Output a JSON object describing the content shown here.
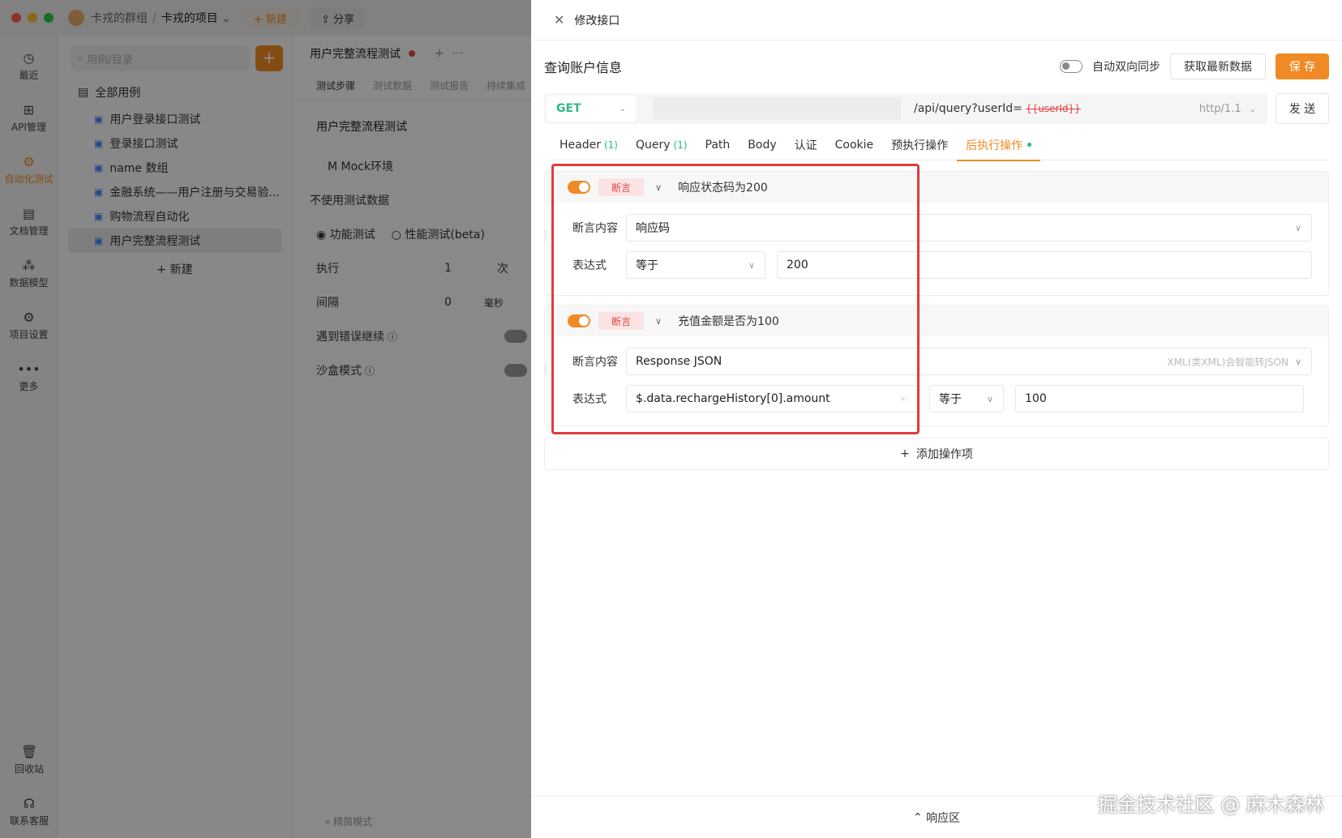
{
  "app": {
    "team": "卡戎的群组",
    "project": "卡戎的项目",
    "new_btn": "+ 新建",
    "share_btn": "分享"
  },
  "nav": {
    "items": [
      {
        "label": "最近",
        "icon": "clock-icon",
        "glyph": "◷"
      },
      {
        "label": "API管理",
        "icon": "api-icon",
        "glyph": "⊞"
      },
      {
        "label": "自动化测试",
        "icon": "automation-icon",
        "glyph": "⚙"
      },
      {
        "label": "文档管理",
        "icon": "document-icon",
        "glyph": "▤"
      },
      {
        "label": "数据模型",
        "icon": "model-icon",
        "glyph": "⁂"
      },
      {
        "label": "项目设置",
        "icon": "settings-icon",
        "glyph": "⚙"
      },
      {
        "label": "更多",
        "icon": "more-icon",
        "glyph": "•••"
      }
    ],
    "bottom": [
      {
        "label": "回收站",
        "icon": "trash-icon",
        "glyph": "🗑"
      },
      {
        "label": "联系客服",
        "icon": "headset-icon",
        "glyph": "☊"
      }
    ]
  },
  "tree": {
    "search_placeholder": "用例/目录",
    "add": "+",
    "root": "全部用例",
    "items": [
      "用户登录接口测试",
      "登录接口测试",
      "name 数组",
      "金融系统——用户注册与交易验...",
      "购物流程自动化",
      "用户完整流程测试"
    ],
    "new": "+ 新建"
  },
  "middle": {
    "tab_title": "用户完整流程测试",
    "tab_plus": "+",
    "tab_more": "···",
    "subtabs": [
      "测试步骤",
      "测试数据",
      "测试报告",
      "持续集成"
    ],
    "title": "用户完整流程测试",
    "env": "M  Mock环境",
    "test_data": "不使用测试数据",
    "mode_func": "功能测试",
    "mode_perf": "性能测试(beta)",
    "exec_label": "执行",
    "exec_value": "1",
    "exec_unit": "次",
    "interval_label": "间隔",
    "interval_value": "0",
    "interval_unit": "毫秒",
    "error_continue": "遇到错误继续",
    "sandbox": "沙盒模式",
    "compact": "精简模式"
  },
  "drawer": {
    "close": "✕",
    "title": "修改接口",
    "api_name": "查询账户信息",
    "sync_label": "自动双向同步",
    "fetch_btn": "获取最新数据",
    "save_btn": "保 存",
    "method": "GET",
    "path": "/api/query?userId=",
    "path_var": "{{userId}}",
    "protocol": "http/1.1",
    "send_btn": "发 送",
    "tabs": [
      {
        "label": "Header",
        "count": "(1)"
      },
      {
        "label": "Query",
        "count": "(1)"
      },
      {
        "label": "Path",
        "count": ""
      },
      {
        "label": "Body",
        "count": ""
      },
      {
        "label": "认证",
        "count": ""
      },
      {
        "label": "Cookie",
        "count": ""
      },
      {
        "label": "预执行操作",
        "count": ""
      },
      {
        "label": "后执行操作",
        "count": ""
      }
    ],
    "ops": [
      {
        "type": "断言",
        "name": "响应状态码为200",
        "content_label": "断言内容",
        "content_value": "响应码",
        "expr_label": "表达式",
        "operator": "等于",
        "value": "200"
      },
      {
        "type": "断言",
        "name": "充值金额是否为100",
        "content_label": "断言内容",
        "content_value": "Response JSON",
        "content_hint": "XML(类XML)会智能转JSON",
        "expr_label": "表达式",
        "expression": "$.data.rechargeHistory[0].amount",
        "operator": "等于",
        "value": "100"
      }
    ],
    "add_op": "添加操作项",
    "response_area": "响应区",
    "watermark": "掘金技术社区 @ 麻木森林"
  },
  "colors": {
    "accent": "#f08a24",
    "get_method": "#2eb888",
    "assert_red": "#e04646",
    "highlight_border": "#e03c3c"
  }
}
